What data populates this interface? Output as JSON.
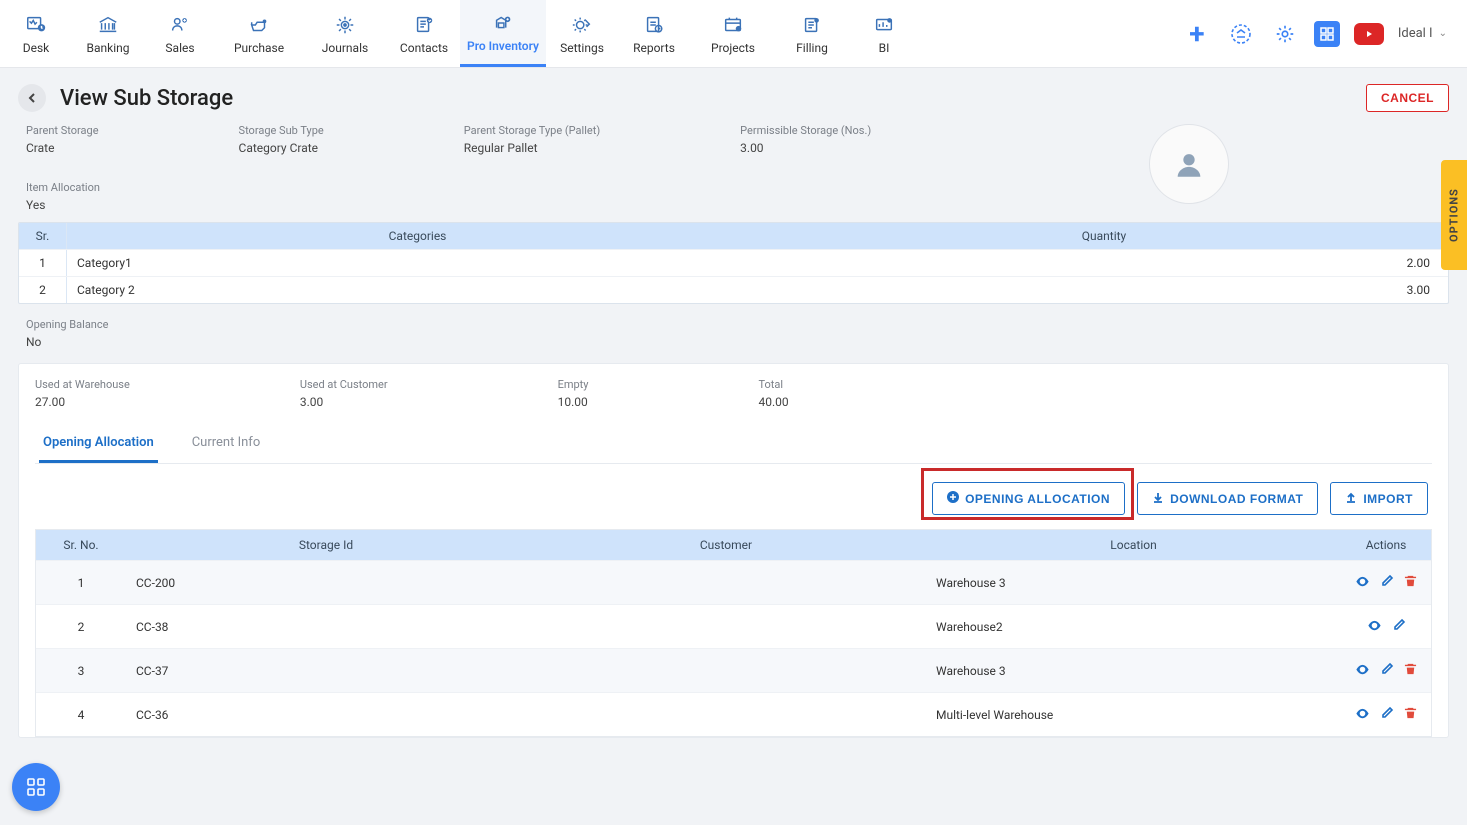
{
  "nav": {
    "items": [
      {
        "label": "Desk"
      },
      {
        "label": "Banking"
      },
      {
        "label": "Sales"
      },
      {
        "label": "Purchase"
      },
      {
        "label": "Journals"
      },
      {
        "label": "Contacts"
      },
      {
        "label": "Pro Inventory"
      },
      {
        "label": "Settings"
      },
      {
        "label": "Reports"
      },
      {
        "label": "Projects"
      },
      {
        "label": "Filling"
      },
      {
        "label": "BI"
      }
    ],
    "user_label": "Ideal I"
  },
  "page": {
    "title": "View Sub Storage",
    "cancel": "CANCEL",
    "info": {
      "parent_storage_lbl": "Parent Storage",
      "parent_storage_val": "Crate",
      "sub_type_lbl": "Storage Sub Type",
      "sub_type_val": "Category Crate",
      "parent_type_lbl": "Parent Storage Type (Pallet)",
      "parent_type_val": "Regular Pallet",
      "permissible_lbl": "Permissible Storage (Nos.)",
      "permissible_val": "3.00"
    },
    "item_allocation_lbl": "Item Allocation",
    "item_allocation_val": "Yes",
    "opening_balance_lbl": "Opening Balance",
    "opening_balance_val": "No",
    "cat_table": {
      "headers": {
        "sr": "Sr.",
        "categories": "Categories",
        "quantity": "Quantity"
      },
      "rows": [
        {
          "sr": "1",
          "cat": "Category1",
          "qty": "2.00"
        },
        {
          "sr": "2",
          "cat": "Category 2",
          "qty": "3.00"
        }
      ]
    },
    "stats": {
      "warehouse_lbl": "Used at Warehouse",
      "warehouse_val": "27.00",
      "customer_lbl": "Used at Customer",
      "customer_val": "3.00",
      "empty_lbl": "Empty",
      "empty_val": "10.00",
      "total_lbl": "Total",
      "total_val": "40.00"
    },
    "tabs": {
      "opening": "Opening Allocation",
      "current": "Current Info"
    },
    "buttons": {
      "opening_allocation": "OPENING ALLOCATION",
      "download_format": "DOWNLOAD FORMAT",
      "import": "IMPORT"
    },
    "alloc_table": {
      "headers": {
        "sr": "Sr. No.",
        "sid": "Storage Id",
        "cust": "Customer",
        "loc": "Location",
        "act": "Actions"
      },
      "rows": [
        {
          "sr": "1",
          "sid": "CC-200",
          "cust": "",
          "loc": "Warehouse 3",
          "del": true
        },
        {
          "sr": "2",
          "sid": "CC-38",
          "cust": "",
          "loc": "Warehouse2",
          "del": false
        },
        {
          "sr": "3",
          "sid": "CC-37",
          "cust": "",
          "loc": "Warehouse 3",
          "del": true
        },
        {
          "sr": "4",
          "sid": "CC-36",
          "cust": "",
          "loc": "Multi-level Warehouse",
          "del": true
        }
      ]
    }
  },
  "options_label": "OPTIONS"
}
